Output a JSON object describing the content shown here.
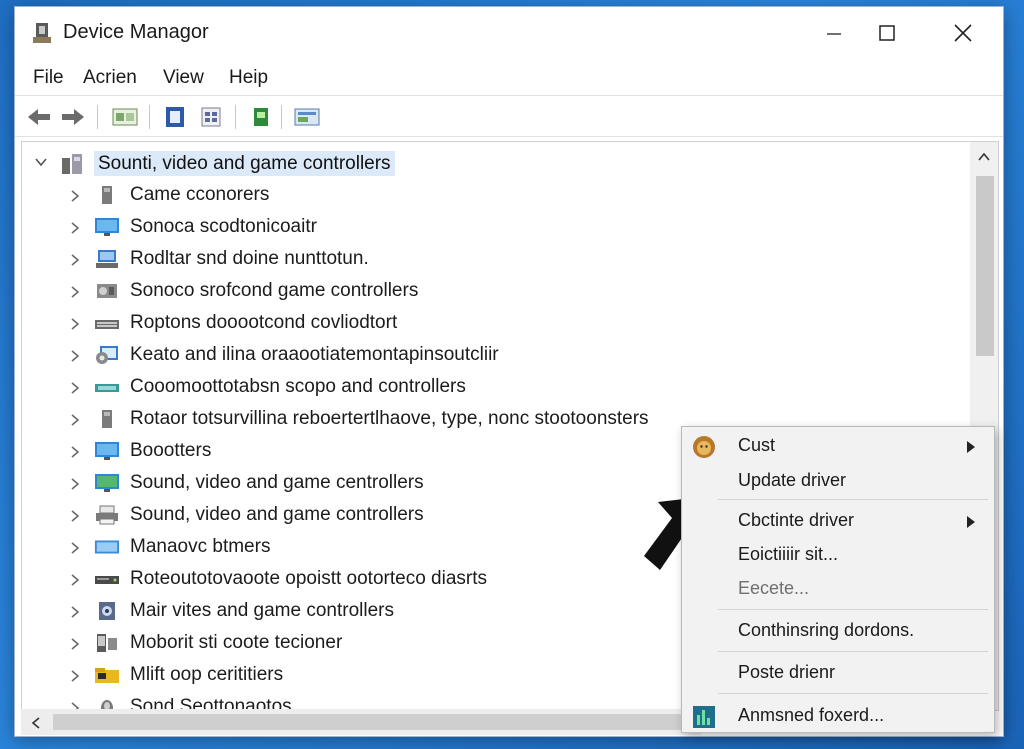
{
  "window": {
    "title": "Device Managor"
  },
  "menu": [
    "File",
    "Acrien",
    "View",
    "Heip"
  ],
  "tree": {
    "root_label": "Sounti, video and game controllers",
    "items": [
      {
        "label": "Came cconorers",
        "icon": "speaker-icon"
      },
      {
        "label": "Sonoca scodtonicoaitr",
        "icon": "monitor-icon"
      },
      {
        "label": "Rodltar snd doine nunttotun.",
        "icon": "network-icon"
      },
      {
        "label": "Sonoco srofcond game controllers",
        "icon": "device-icon"
      },
      {
        "label": "Roptons dooootcond covliodtort",
        "icon": "keyboard-icon"
      },
      {
        "label": "Keato and ilina oraaootiatemontapinsoutcliir",
        "icon": "gear-monitor-icon"
      },
      {
        "label": "Cooomoottotabsn scopo and controllers",
        "icon": "adapter-icon"
      },
      {
        "label": "Rotaor totsurvillina reboertertlhaove, type, nonc stootoonsters",
        "icon": "speaker-icon"
      },
      {
        "label": "Boootters",
        "icon": "monitor-icon"
      },
      {
        "label": "Sound, video and game centrollers",
        "icon": "monitor-green-icon"
      },
      {
        "label": "Sound, video and game controllers",
        "icon": "printer-icon"
      },
      {
        "label": "Manaovc btmers",
        "icon": "display-adapter-icon"
      },
      {
        "label": "Roteoutotovaoote opoistt ootorteco diasrts",
        "icon": "drive-icon"
      },
      {
        "label": "Mair vites and game controllers",
        "icon": "camera-icon"
      },
      {
        "label": "Moborit sti coote tecioner",
        "icon": "phone-icon"
      },
      {
        "label": "Mlift oop cerititiers",
        "icon": "folder-icon"
      },
      {
        "label": "Sond Seottonaotos",
        "icon": "mouse-icon"
      }
    ]
  },
  "context_menu": [
    {
      "label": "Cust",
      "submenu": true,
      "icon": "lion-icon"
    },
    {
      "label": "Update driver"
    },
    {
      "label": "Cbctinte driver",
      "submenu": true
    },
    {
      "label": "Eoictiiiir sit..."
    },
    {
      "label": "Eecete...",
      "disabled": true
    },
    {
      "label": "Conthinsring dordons."
    },
    {
      "label": "Poste drienr"
    },
    {
      "label": "Anmsned foxerd...",
      "icon": "chart-icon"
    }
  ],
  "colors": {
    "selection": "#dbe9f8",
    "desktop": "#2b86dc",
    "menu_bg": "#f2f2f2"
  }
}
